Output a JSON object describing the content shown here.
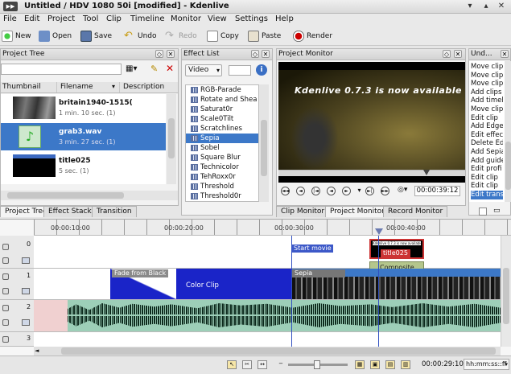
{
  "window": {
    "title": "Untitled / HDV 1080 50i [modified] - Kdenlive"
  },
  "menu": [
    "File",
    "Edit",
    "Project",
    "Tool",
    "Clip",
    "Timeline",
    "Monitor",
    "View",
    "Settings",
    "Help"
  ],
  "toolbar": {
    "new": "New",
    "open": "Open",
    "save": "Save",
    "undo": "Undo",
    "redo": "Redo",
    "copy": "Copy",
    "paste": "Paste",
    "render": "Render"
  },
  "project_tree": {
    "title": "Project Tree",
    "columns": [
      "Thumbnail",
      "Filename",
      "Description"
    ],
    "items": [
      {
        "name": "britain1940-1515(",
        "info": "1 min. 10 sec. (1)"
      },
      {
        "name": "grab3.wav",
        "info": "3 min. 27 sec. (1)"
      },
      {
        "name": "title025",
        "info": "5 sec. (1)"
      }
    ]
  },
  "effect_list": {
    "title": "Effect List",
    "filter": "Video",
    "items": [
      "RGB-Parade",
      "Rotate and Shea",
      "Saturat0r",
      "Scale0Tilt",
      "Scratchlines",
      "Sepia",
      "Sobel",
      "Square Blur",
      "Technicolor",
      "TehRoxx0r",
      "Threshold",
      "Threshold0r"
    ],
    "selected": "Sepia"
  },
  "project_monitor": {
    "title": "Project Monitor",
    "overlay_text": "Kdenlive 0.7.3 is now available",
    "timecode": "00:00:39:12"
  },
  "undo": {
    "title": "Und...",
    "items": [
      "Move clip",
      "Move clip",
      "Move clip",
      "Add clips",
      "Add timel",
      "Move clip",
      "Edit clip",
      "Add Edge",
      "Edit effect",
      "Delete Ed",
      "Add Sepia",
      "Add guide",
      "Edit profi",
      "Edit clip",
      "Edit clip",
      "Edit trans"
    ],
    "selected": "Edit trans"
  },
  "tabs_left": [
    "Project Tree",
    "Effect Stack",
    "Transition"
  ],
  "tabs_monitor": [
    "Clip Monitor",
    "Project Monitor",
    "Record Monitor"
  ],
  "timeline": {
    "ruler": [
      "00:00:10:00",
      "00:00:20:00",
      "00:00:30:00",
      "00:00:40:00"
    ],
    "tracks": [
      "0",
      "1",
      "2",
      "3"
    ],
    "clips": {
      "title_small": "Kdenlive 0.7.3 is now available",
      "title": "title025",
      "composite": "Composite",
      "guide": "Start movie",
      "transition": "Fade from Black",
      "color": "Color Clip",
      "sepia": "Sepia"
    }
  },
  "statusbar": {
    "timecode": "00:00:29:10",
    "format": "hh:mm:ss::ff"
  },
  "colors": {
    "selection": "#3c78c8",
    "color_clip": "#1a24c8",
    "audio_bg": "#9dcfb8"
  }
}
